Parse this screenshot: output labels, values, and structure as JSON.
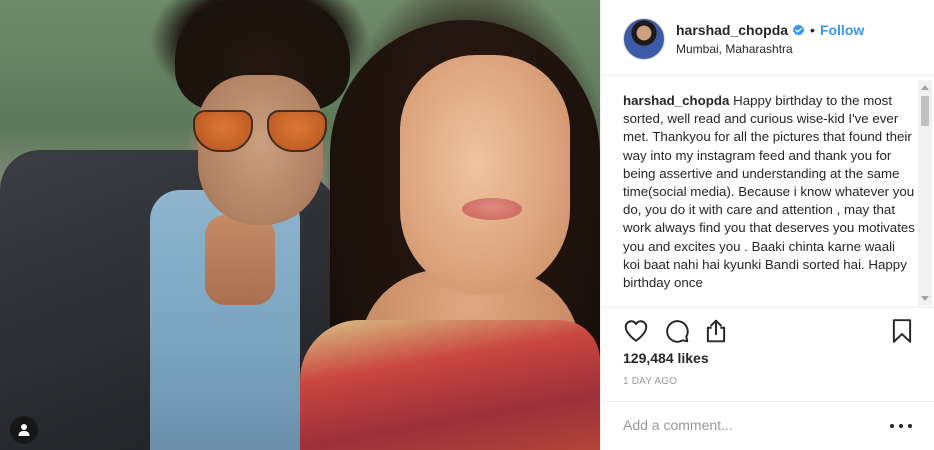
{
  "post": {
    "username": "harshad_chopda",
    "follow_label": "Follow",
    "separator": "•",
    "location": "Mumbai, Maharashtra",
    "caption_username": "harshad_chopda",
    "caption_text": " Happy birthday to the most sorted, well read and curious wise-kid I've ever met. Thankyou for all the pictures that found their way into my instagram feed and thank you for being assertive and understanding at the same time(social media). Because i know whatever you do, you do it with care and attention , may that work always find you that deserves you motivates you and excites you . Baaki chinta karne waali koi baat nahi hai kyunki Bandi sorted hai. Happy birthday once",
    "likes": "129,484 likes",
    "timestamp": "1 DAY AGO"
  },
  "comment": {
    "placeholder": "Add a comment..."
  },
  "icons": {
    "verified": "verified-badge-icon",
    "like": "heart-icon",
    "comment": "comment-icon",
    "share": "share-icon",
    "save": "bookmark-icon",
    "more": "more-options-icon",
    "tag": "person-tag-icon"
  },
  "colors": {
    "link_blue": "#3897f0",
    "text": "#262626",
    "muted": "#999999",
    "border": "#efefef"
  }
}
